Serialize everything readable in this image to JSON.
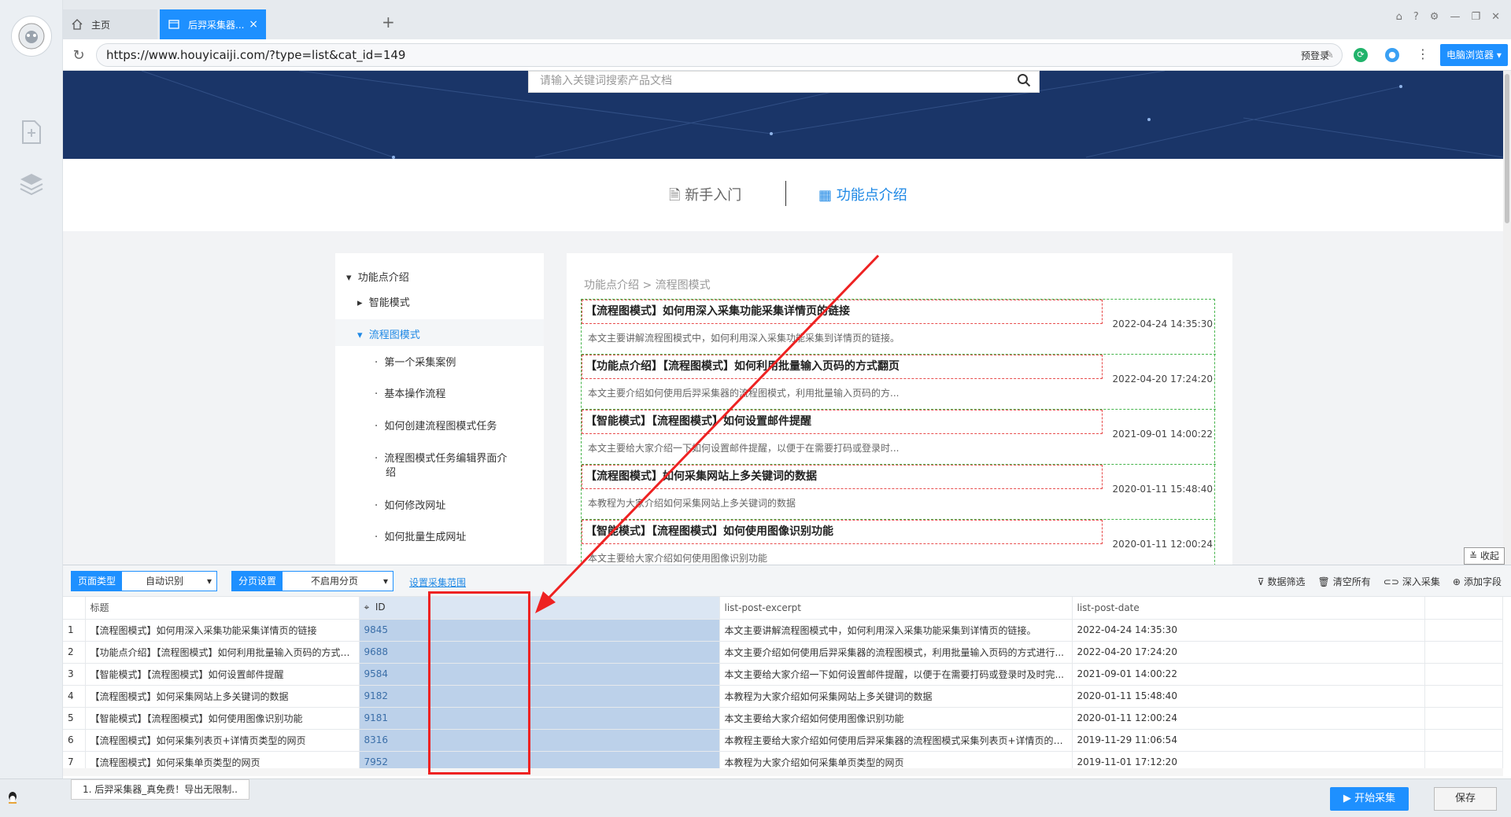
{
  "tabs": {
    "home_label": "主页",
    "active_label": "后羿采集器...",
    "new_tab": "+"
  },
  "address": {
    "url": "https://www.houyicaiji.com/?type=list&cat_id=149",
    "prelogin": "预登录",
    "browser_btn": "电脑浏览器"
  },
  "site": {
    "search_placeholder": "请输入关键词搜索产品文档",
    "nav_newbie": "新手入门",
    "nav_func": "功能点介绍",
    "sidebar": {
      "root": "功能点介绍",
      "smart": "智能模式",
      "flow": "流程图模式",
      "subs": [
        "第一个采集案例",
        "基本操作流程",
        "如何创建流程图模式任务",
        "流程图模式任务编辑界面介",
        "绍",
        "如何修改网址",
        "如何批量生成网址"
      ]
    },
    "breadcrumb": "功能点介绍 > 流程图模式",
    "articles": [
      {
        "title": "【流程图模式】如何用深入采集功能采集详情页的链接",
        "excerpt": "本文主要讲解流程图模式中，如何利用深入采集功能采集到详情页的链接。",
        "date": "2022-04-24 14:35:30"
      },
      {
        "title": "【功能点介绍】【流程图模式】如何利用批量输入页码的方式翻页",
        "excerpt": "本文主要介绍如何使用后羿采集器的流程图模式，利用批量输入页码的方...",
        "date": "2022-04-20 17:24:20"
      },
      {
        "title": "【智能模式】【流程图模式】如何设置邮件提醒",
        "excerpt": "本文主要给大家介绍一下如何设置邮件提醒，以便于在需要打码或登录时...",
        "date": "2021-09-01 14:00:22"
      },
      {
        "title": "【流程图模式】如何采集网站上多关键词的数据",
        "excerpt": "本教程为大家介绍如何采集网站上多关键词的数据",
        "date": "2020-01-11 15:48:40"
      },
      {
        "title": "【智能模式】【流程图模式】如何使用图像识别功能",
        "excerpt": "本文主要给大家介绍如何使用图像识别功能",
        "date": "2020-01-11 12:00:24"
      }
    ],
    "collapse": "收起"
  },
  "collector": {
    "page_type_label": "页面类型",
    "page_type_value": "自动识别",
    "paging_label": "分页设置",
    "paging_value": "不启用分页",
    "range_link": "设置采集范围",
    "tools": [
      "数据筛选",
      "清空所有",
      "深入采集",
      "添加字段"
    ],
    "columns": [
      "标题",
      "ID",
      "list-post-excerpt",
      "list-post-date"
    ],
    "rows": [
      {
        "n": "1",
        "title": "【流程图模式】如何用深入采集功能采集详情页的链接",
        "id": "9845",
        "excerpt": "本文主要讲解流程图模式中，如何利用深入采集功能采集到详情页的链接。",
        "date": "2022-04-24 14:35:30"
      },
      {
        "n": "2",
        "title": "【功能点介绍】【流程图模式】如何利用批量输入页码的方式翻页",
        "id": "9688",
        "excerpt": "本文主要介绍如何使用后羿采集器的流程图模式，利用批量输入页码的方式进行...",
        "date": "2022-04-20 17:24:20"
      },
      {
        "n": "3",
        "title": "【智能模式】【流程图模式】如何设置邮件提醒",
        "id": "9584",
        "excerpt": "本文主要给大家介绍一下如何设置邮件提醒，以便于在需要打码或登录时及时完...",
        "date": "2021-09-01 14:00:22"
      },
      {
        "n": "4",
        "title": "【流程图模式】如何采集网站上多关键词的数据",
        "id": "9182",
        "excerpt": "本教程为大家介绍如何采集网站上多关键词的数据",
        "date": "2020-01-11 15:48:40"
      },
      {
        "n": "5",
        "title": "【智能模式】【流程图模式】如何使用图像识别功能",
        "id": "9181",
        "excerpt": "本文主要给大家介绍如何使用图像识别功能",
        "date": "2020-01-11 12:00:24"
      },
      {
        "n": "6",
        "title": "【流程图模式】如何采集列表页+详情页类型的网页",
        "id": "8316",
        "excerpt": "本教程主要给大家介绍如何使用后羿采集器的流程图模式采集列表页+详情页的数...",
        "date": "2019-11-29 11:06:54"
      },
      {
        "n": "7",
        "title": "【流程图模式】如何采集单页类型的网页",
        "id": "7952",
        "excerpt": "本教程为大家介绍如何采集单页类型的网页",
        "date": "2019-11-01 17:12:20"
      }
    ]
  },
  "footer": {
    "status_tab": "1. 后羿采集器_真免费！导出无限制..",
    "start_btn": "开始采集",
    "save_btn": "保存"
  },
  "colors": {
    "accent": "#1e90ff",
    "annotation_red": "#ee2222",
    "id_column": "#bcd1ea"
  }
}
